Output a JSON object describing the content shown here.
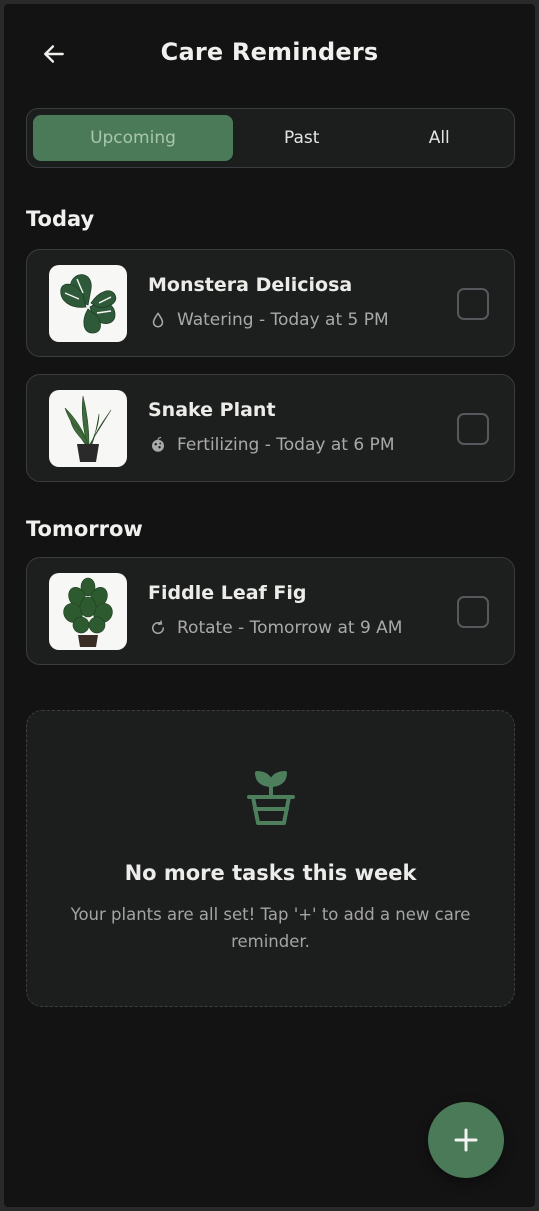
{
  "header": {
    "title": "Care Reminders"
  },
  "tabs": [
    {
      "label": "Upcoming",
      "active": true
    },
    {
      "label": "Past",
      "active": false
    },
    {
      "label": "All",
      "active": false
    }
  ],
  "sections": [
    {
      "label": "Today",
      "items": [
        {
          "name": "Monstera Deliciosa",
          "task": "Watering - Today at 5 PM",
          "icon": "water-drop-icon"
        },
        {
          "name": "Snake Plant",
          "task": "Fertilizing - Today at 6 PM",
          "icon": "fertilizer-icon"
        }
      ]
    },
    {
      "label": "Tomorrow",
      "items": [
        {
          "name": "Fiddle Leaf Fig",
          "task": "Rotate - Tomorrow at 9 AM",
          "icon": "rotate-icon"
        }
      ]
    }
  ],
  "empty_state": {
    "title": "No more tasks this week",
    "text": "Your plants are all set! Tap '+' to add a new care reminder.",
    "icon": "potted-sprout-icon"
  },
  "fab": {
    "icon": "plus-icon"
  },
  "colors": {
    "accent": "#4b7a58",
    "background": "#121312",
    "card": "#1d1e1e"
  }
}
